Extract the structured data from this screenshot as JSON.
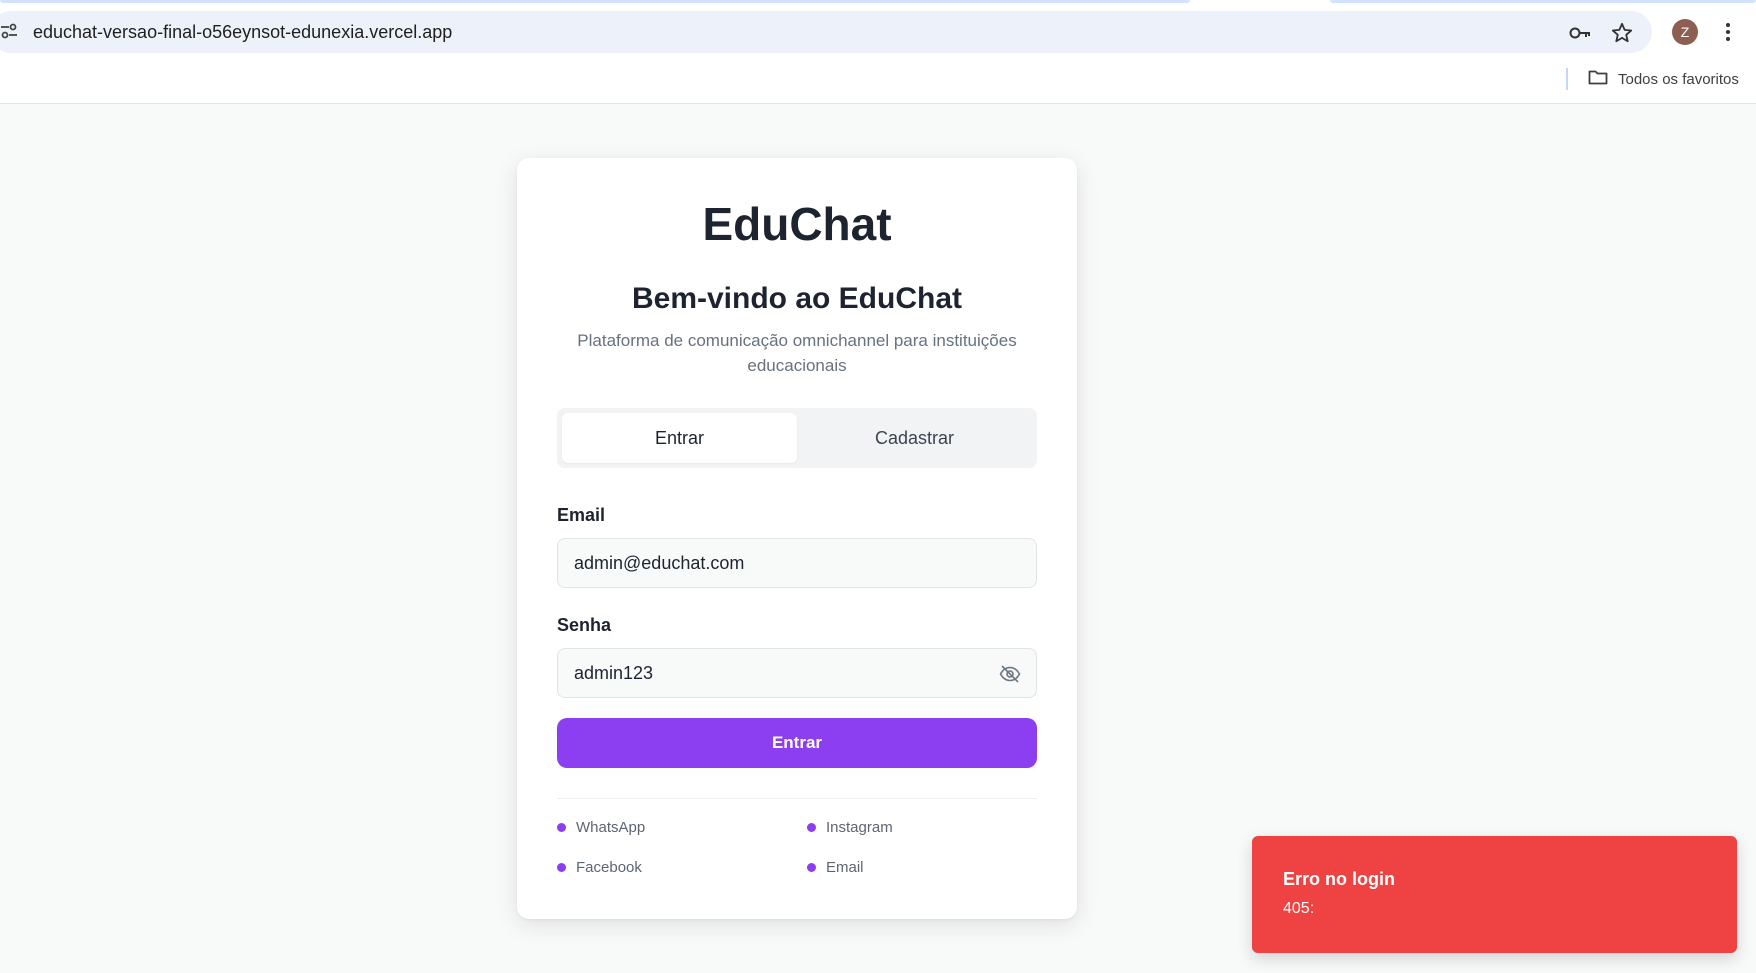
{
  "browser": {
    "url": "educhat-versao-final-o56eynsot-edunexia.vercel.app",
    "profile_initial": "Z",
    "bookmarks_folder_label": "Todos os favoritos",
    "icons": [
      "site-info-icon",
      "key-icon",
      "star-icon",
      "more-vert-icon",
      "folder-icon"
    ]
  },
  "login": {
    "brand": "EduChat",
    "welcome": "Bem-vindo ao EduChat",
    "subtitle": "Plataforma de comunicação omnichannel para instituições educacionais",
    "tabs": [
      {
        "label": "Entrar",
        "active": true
      },
      {
        "label": "Cadastrar",
        "active": false
      }
    ],
    "email": {
      "label": "Email",
      "value": "admin@educhat.com"
    },
    "password": {
      "label": "Senha",
      "value": "admin123",
      "icon": "eye-off-icon"
    },
    "submit_label": "Entrar",
    "channels": [
      "WhatsApp",
      "Instagram",
      "Facebook",
      "Email"
    ]
  },
  "toast": {
    "title": "Erro no login",
    "message": "405:"
  },
  "colors": {
    "accent": "#8b3ff0",
    "error": "#ef4343",
    "page_background": "#f8f9f9"
  }
}
